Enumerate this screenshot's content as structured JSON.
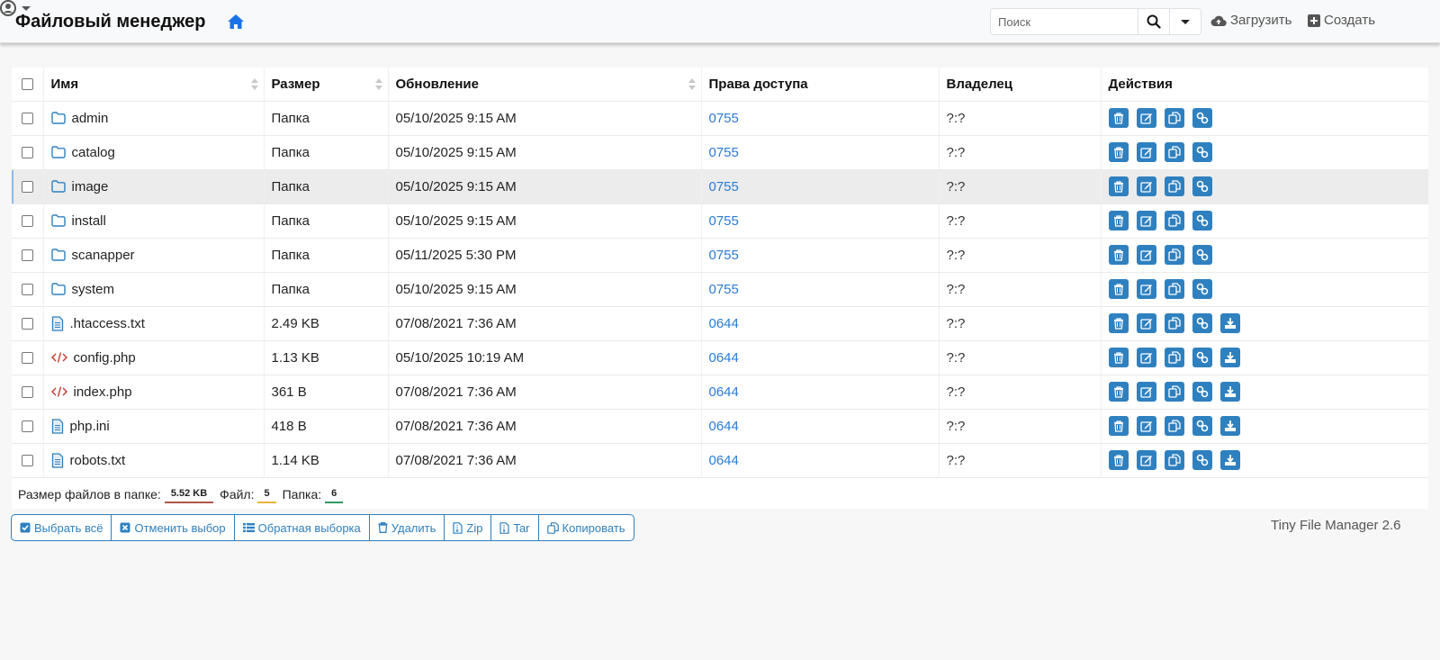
{
  "header": {
    "title": "Файловый менеджер",
    "search_placeholder": "Поиск",
    "upload_label": "Загрузить",
    "create_label": "Создать"
  },
  "table": {
    "columns": [
      "Имя",
      "Размер",
      "Обновление",
      "Права доступа",
      "Владелец",
      "Действия"
    ],
    "rows": [
      {
        "name": "admin",
        "type": "folder",
        "size": "Папка",
        "modified": "05/10/2025 9:15 AM",
        "perms": "0755",
        "owner": "?:?"
      },
      {
        "name": "catalog",
        "type": "folder",
        "size": "Папка",
        "modified": "05/10/2025 9:15 AM",
        "perms": "0755",
        "owner": "?:?"
      },
      {
        "name": "image",
        "type": "folder",
        "size": "Папка",
        "modified": "05/10/2025 9:15 AM",
        "perms": "0755",
        "owner": "?:?"
      },
      {
        "name": "install",
        "type": "folder",
        "size": "Папка",
        "modified": "05/10/2025 9:15 AM",
        "perms": "0755",
        "owner": "?:?"
      },
      {
        "name": "scanapper",
        "type": "folder",
        "size": "Папка",
        "modified": "05/11/2025 5:30 PM",
        "perms": "0755",
        "owner": "?:?"
      },
      {
        "name": "system",
        "type": "folder",
        "size": "Папка",
        "modified": "05/10/2025 9:15 AM",
        "perms": "0755",
        "owner": "?:?"
      },
      {
        "name": ".htaccess.txt",
        "type": "text",
        "size": "2.49 KB",
        "modified": "07/08/2021 7:36 AM",
        "perms": "0644",
        "owner": "?:?"
      },
      {
        "name": "config.php",
        "type": "code",
        "size": "1.13 KB",
        "modified": "05/10/2025 10:19 AM",
        "perms": "0644",
        "owner": "?:?"
      },
      {
        "name": "index.php",
        "type": "code",
        "size": "361 B",
        "modified": "07/08/2021 7:36 AM",
        "perms": "0644",
        "owner": "?:?"
      },
      {
        "name": "php.ini",
        "type": "text",
        "size": "418 B",
        "modified": "07/08/2021 7:36 AM",
        "perms": "0644",
        "owner": "?:?"
      },
      {
        "name": "robots.txt",
        "type": "text",
        "size": "1.14 KB",
        "modified": "07/08/2021 7:36 AM",
        "perms": "0644",
        "owner": "?:?"
      }
    ],
    "highlighted_row": 2
  },
  "summary": {
    "size_label": "Размер файлов в папке:",
    "size_value": "5.52 KB",
    "files_label": "Файл:",
    "files_value": "5",
    "folders_label": "Папка:",
    "folders_value": "6"
  },
  "bulk_actions": [
    {
      "label": "Выбрать всё",
      "icon": "check-square-icon"
    },
    {
      "label": "Отменить выбор",
      "icon": "x-square-icon"
    },
    {
      "label": "Обратная выборка",
      "icon": "list-icon"
    },
    {
      "label": "Удалить",
      "icon": "trash-icon"
    },
    {
      "label": "Zip",
      "icon": "zip-file-icon"
    },
    {
      "label": "Tar",
      "icon": "tar-file-icon"
    },
    {
      "label": "Копировать",
      "icon": "copy-icon"
    }
  ],
  "version": "Tiny File Manager 2.6",
  "colors": {
    "accent": "#2f80bf",
    "link": "#2c7bd6",
    "home": "#1a73e8"
  }
}
